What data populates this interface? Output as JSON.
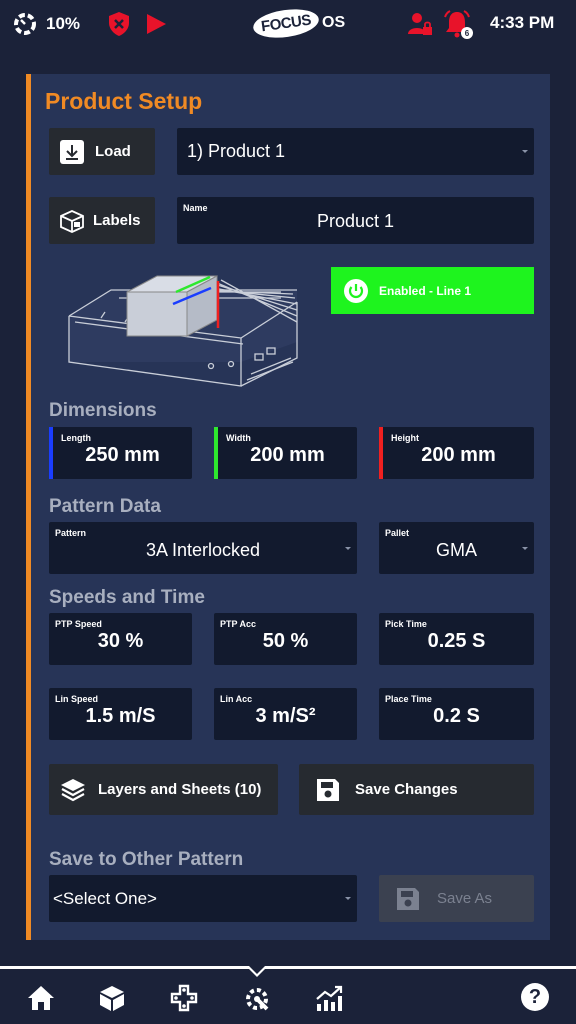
{
  "status_bar": {
    "battery": "10%",
    "logo_main": "FOCUS",
    "logo_suffix": "OS",
    "notification_count": "6",
    "time": "4:33 PM"
  },
  "colors": {
    "accent_orange": "#f08a24",
    "panel": "#273457",
    "field_bg": "#121a2e",
    "enabled_green": "#1ef41e",
    "length_blue": "#1a3dff",
    "width_green": "#2ee82e",
    "height_red": "#f02020"
  },
  "product_setup": {
    "title": "Product Setup",
    "load_label": "Load",
    "product_select": "1) Product 1",
    "labels_label": "Labels",
    "name_label": "Name",
    "name_value": "Product 1",
    "enabled_label": "Enabled - Line 1"
  },
  "dimensions": {
    "title": "Dimensions",
    "length_label": "Length",
    "length_value": "250 mm",
    "width_label": "Width",
    "width_value": "200 mm",
    "height_label": "Height",
    "height_value": "200 mm"
  },
  "pattern_data": {
    "title": "Pattern Data",
    "pattern_label": "Pattern",
    "pattern_value": "3A Interlocked",
    "pallet_label": "Pallet",
    "pallet_value": "GMA"
  },
  "speeds": {
    "title": "Speeds and Time",
    "ptp_speed_label": "PTP Speed",
    "ptp_speed_value": "30 %",
    "ptp_acc_label": "PTP Acc",
    "ptp_acc_value": "50 %",
    "pick_time_label": "Pick Time",
    "pick_time_value": "0.25 S",
    "lin_speed_label": "Lin Speed",
    "lin_speed_value": "1.5 m/S",
    "lin_acc_label": "Lin Acc",
    "lin_acc_value": "3 m/S²",
    "place_time_label": "Place Time",
    "place_time_value": "0.2 S"
  },
  "actions": {
    "layers_label": "Layers and Sheets (10)",
    "save_changes_label": "Save Changes"
  },
  "save_other": {
    "title": "Save to Other Pattern",
    "select_value": "<Select One>",
    "save_as_label": "Save As"
  },
  "bottom_nav": {
    "items": [
      "home-icon",
      "box-icon",
      "gamepad-icon",
      "settings-wrench-icon",
      "chart-icon",
      "help-icon"
    ],
    "help_glyph": "?"
  }
}
